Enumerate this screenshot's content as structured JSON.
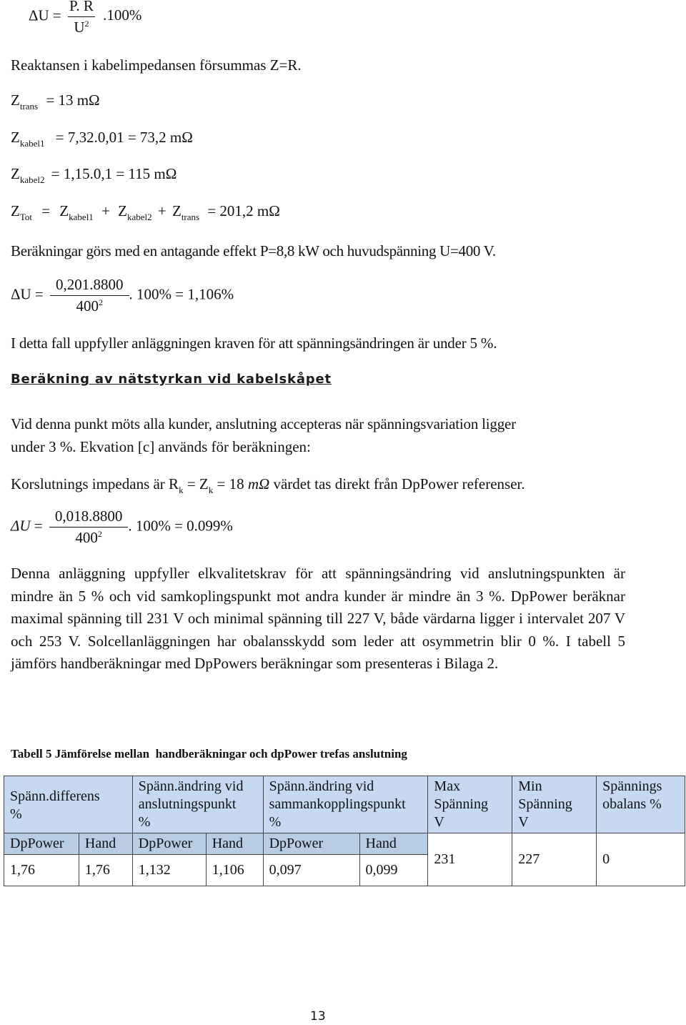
{
  "formula_general": {
    "lhs": "ΔU =",
    "numerator": "P. R",
    "denominator": "U",
    "denominator_exp": "2",
    "suffix": ".100%"
  },
  "note_reactance": "Reaktansen i kabelimpedansen försummas Z=R.",
  "z_trans": {
    "symbol": "Z",
    "sub": "trans",
    "expr": "= 13 mΩ"
  },
  "z_kabel1": {
    "symbol": "Z",
    "sub": "kabel1",
    "expr": "= 7,32.0,01 = 73,2 mΩ"
  },
  "z_kabel2": {
    "symbol": "Z",
    "sub": "kabel2",
    "expr": "= 1,15.0,1 = 115 mΩ"
  },
  "z_tot": {
    "symbol": "Z",
    "sub": "Tot",
    "eq": "=",
    "t1": "Z",
    "t1_sub": "kabel1",
    "plus1": "+",
    "t2": "Z",
    "t2_sub": "kabel2",
    "plus2": "+",
    "t3": "Z",
    "t3_sub": "trans",
    "result": "= 201,2 mΩ"
  },
  "assumption": "Beräkningar görs med en antagande effekt P=8,8 kW och huvudspänning U=400 V.",
  "formula_calc1": {
    "lhs": "ΔU =",
    "numerator": "0,201.8800",
    "denominator": "400",
    "denominator_exp": "2",
    "suffix": ". 100% = 1,106%"
  },
  "conclusion1": "I detta fall uppfyller anläggningen kraven för att spänningsändringen är under 5 %.",
  "section_heading": "Beräkning av nätstyrkan vid kabelskåpet",
  "para_point_line1": "Vid denna punkt möts alla kunder, anslutning accepteras när spänningsvariation ligger",
  "para_point_line2": "under 3 %. Ekvation [c] används för beräkningen:",
  "korslutning": {
    "prefix": "Korslutnings impedans är R",
    "r_sub": "k",
    "mid": " = Z",
    "z_sub": "k",
    "value": " = 18 ",
    "unit": "mΩ",
    "suffix": " värdet tas direkt från DpPower referenser."
  },
  "formula_calc2": {
    "lhs": "ΔU",
    "eq": " =",
    "numerator": "0,018.8800",
    "denominator": "400",
    "denominator_exp": "2",
    "suffix": ". 100% = 0.099%"
  },
  "summary_paragraph": "Denna anläggning uppfyller elkvalitetskrav för att spänningsändring vid anslutningspunkten är mindre än 5 % och vid samkoplingspunkt mot andra kunder är mindre än 3 %. DpPower beräknar maximal spänning till 231 V och minimal spänning till 227 V, både värdarna ligger i intervalet 207 V och 253 V. Solcellanläggningen har obalansskydd som leder att osymmetrin blir 0 %. I tabell 5 jämförs handberäkningar med DpPowers beräkningar som presenteras i Bilaga 2.",
  "table": {
    "caption": "Tabell 5 Jämförelse mellan  handberäkningar och dpPower trefas anslutning",
    "headers": [
      {
        "line1": "Spänn.differens",
        "line2": "%",
        "line3": ""
      },
      {
        "line1": "Spänn.ändring vid",
        "line2": "anslutningspunkt",
        "line3": "%"
      },
      {
        "line1": "Spänn.ändring vid",
        "line2": "sammankopplingspunkt",
        "line3": "%"
      },
      {
        "line1": "Max",
        "line2": "Spänning",
        "line3": "V"
      },
      {
        "line1": "Min",
        "line2": "Spänning",
        "line3": "V"
      },
      {
        "line1": "Spännings",
        "line2": "obalans %",
        "line3": ""
      }
    ],
    "subheaders": [
      "DpPower",
      "Hand",
      "DpPower",
      "Hand",
      "DpPower",
      "Hand"
    ],
    "row": [
      "1,76",
      "1,76",
      "1,132",
      "1,106",
      "0,097",
      "0,099"
    ],
    "max_spanning": "231",
    "min_spanning": "227",
    "obalans": "0",
    "header_color": "#c6d9f1",
    "subheader_color": "#b8cce4"
  },
  "page_number": "13"
}
